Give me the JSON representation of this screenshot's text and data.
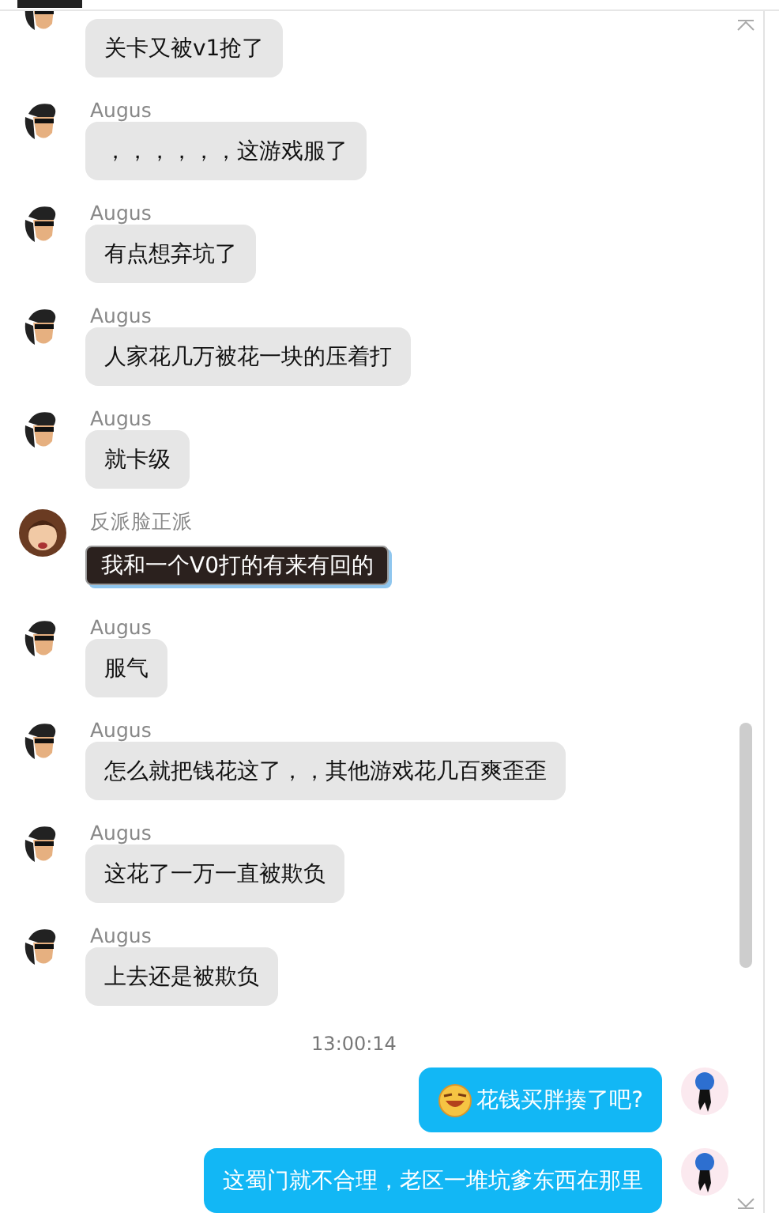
{
  "messages": [
    {
      "kind": "received",
      "text": "关卡又被v1抢了"
    },
    {
      "kind": "received",
      "sender": "Augus",
      "text": "，，，，，，这游戏服了"
    },
    {
      "kind": "received",
      "sender": "Augus",
      "text": "有点想弃坑了"
    },
    {
      "kind": "received",
      "sender": "Augus",
      "text": "人家花几万被花一块的压着打"
    },
    {
      "kind": "received",
      "sender": "Augus",
      "text": "就卡级"
    },
    {
      "kind": "received_dark",
      "sender": "反派脸正派",
      "text": "我和一个V0打的有来有回的"
    },
    {
      "kind": "received",
      "sender": "Augus",
      "text": "服气"
    },
    {
      "kind": "received",
      "sender": "Augus",
      "text": "怎么就把钱花这了，，其他游戏花几百爽歪歪"
    },
    {
      "kind": "received",
      "sender": "Augus",
      "text": "这花了一万一直被欺负"
    },
    {
      "kind": "received",
      "sender": "Augus",
      "text": "上去还是被欺负"
    },
    {
      "kind": "time",
      "text": "13:00:14"
    },
    {
      "kind": "sent",
      "emoji": true,
      "text": "花钱买胖揍了吧?"
    },
    {
      "kind": "sent",
      "emoji": false,
      "text": "这蜀门就不合理，老区一堆坑爹东西在那里"
    }
  ]
}
